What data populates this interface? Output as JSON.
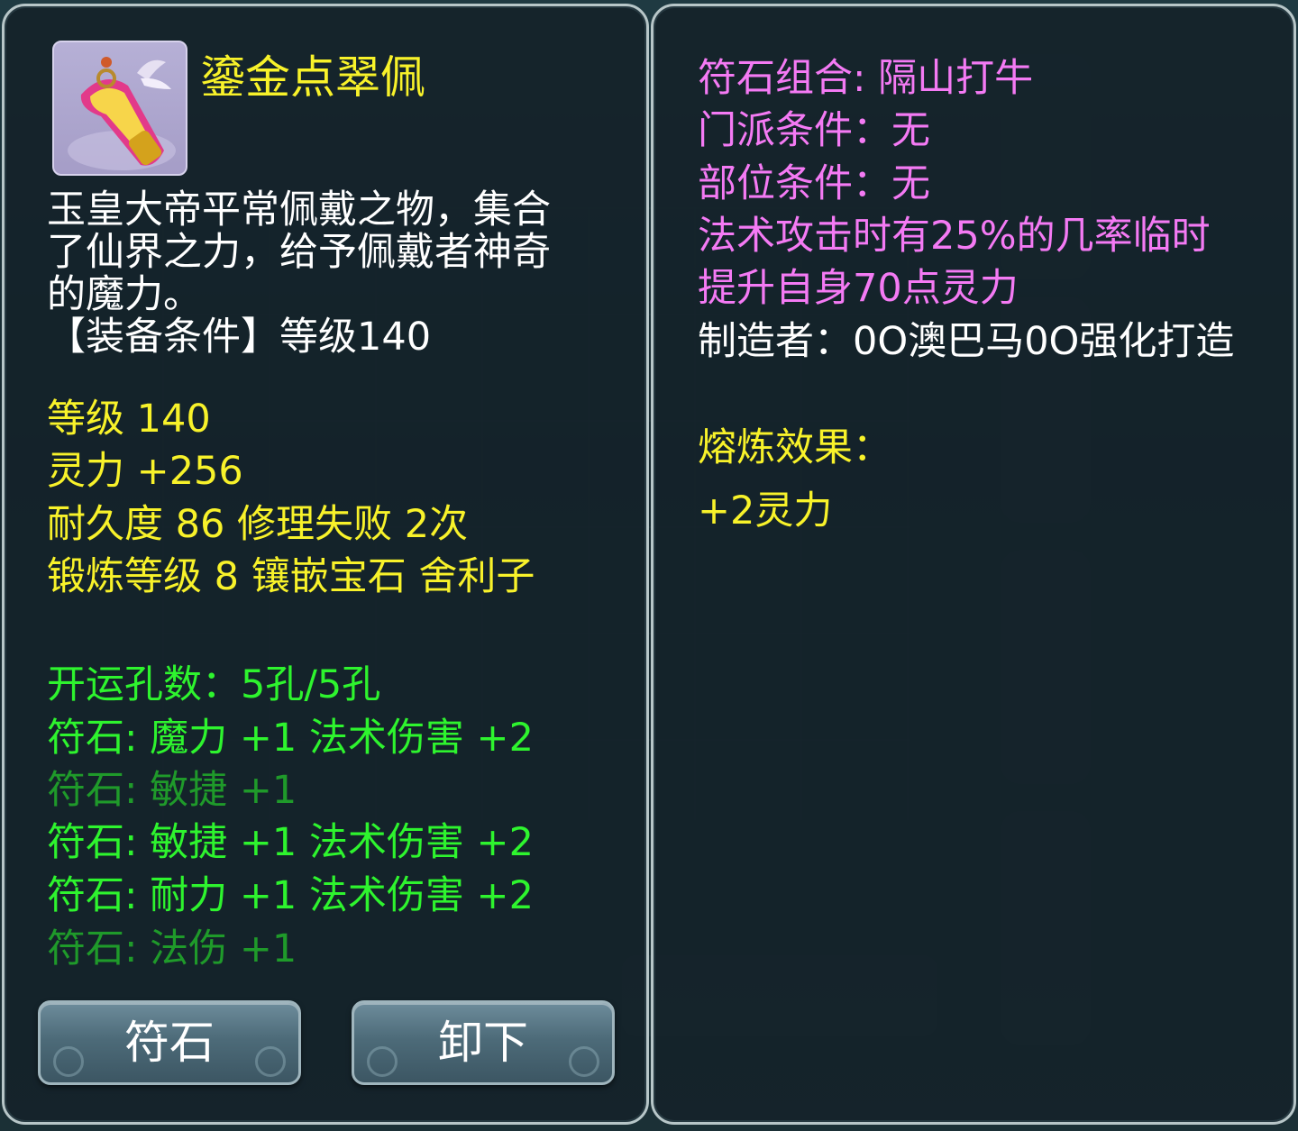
{
  "item": {
    "name": "鎏金点翠佩",
    "icon": "golden-pendant-icon",
    "description": "玉皇大帝平常佩戴之物，集合了仙界之力，给予佩戴者神奇的魔力。",
    "requirement": "【装备条件】等级140"
  },
  "stats": {
    "level": "等级 140",
    "spirit": "灵力 +256",
    "durability": "耐久度 86  修理失败 2次",
    "forge": "锻炼等级 8  镶嵌宝石 舍利子",
    "sockets": "开运孔数：5孔/5孔"
  },
  "runes": [
    "符石: 魔力 +1 法术伤害 +2",
    "符石: 敏捷 +1",
    "符石: 敏捷 +1 法术伤害 +2",
    "符石: 耐力 +1 法术伤害 +2",
    "符石: 法伤 +1"
  ],
  "combo": {
    "name": "符石组合: 隔山打牛",
    "sect_requirement": "门派条件：无",
    "slot_requirement": "部位条件：无",
    "effect": "法术攻击时有25%的几率临时提升自身70点灵力"
  },
  "maker": "制造者：0O澳巴马0O强化打造",
  "smelt": {
    "label": "熔炼效果：",
    "value": "+2灵力"
  },
  "buttons": {
    "rune": "符石",
    "unequip": "卸下"
  },
  "colors": {
    "yellow": "#f8f22a",
    "green": "#2ef42e",
    "dim_green": "#1f9a2a",
    "pink": "#f47af4"
  }
}
